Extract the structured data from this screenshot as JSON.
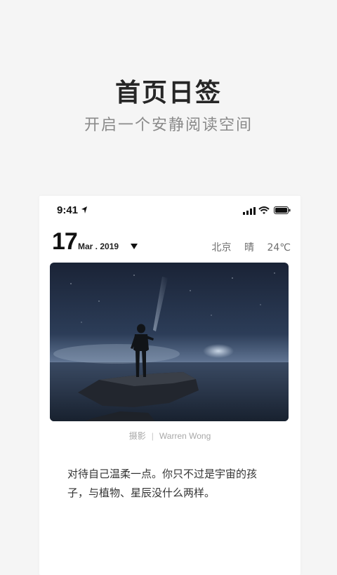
{
  "promo": {
    "title": "首页日签",
    "subtitle": "开启一个安静阅读空间"
  },
  "status_bar": {
    "time": "9:41",
    "icons": [
      "location-arrow-icon",
      "signal-icon",
      "wifi-icon",
      "battery-icon"
    ]
  },
  "date": {
    "day": "17",
    "month_year": "Mar . 2019"
  },
  "weather": {
    "city": "北京",
    "condition": "晴",
    "temperature": "24℃"
  },
  "photo": {
    "credit_label": "摄影",
    "separator": "|",
    "photographer": "Warren Wong"
  },
  "quote": {
    "text": "对待自己温柔一点。你只不过是宇宙的孩子，与植物、星辰没什么两样。"
  },
  "colors": {
    "background": "#f5f5f5",
    "card": "#ffffff",
    "title": "#262626",
    "subtitle": "#8a8a8a",
    "night_sky": "#1c2a40"
  }
}
